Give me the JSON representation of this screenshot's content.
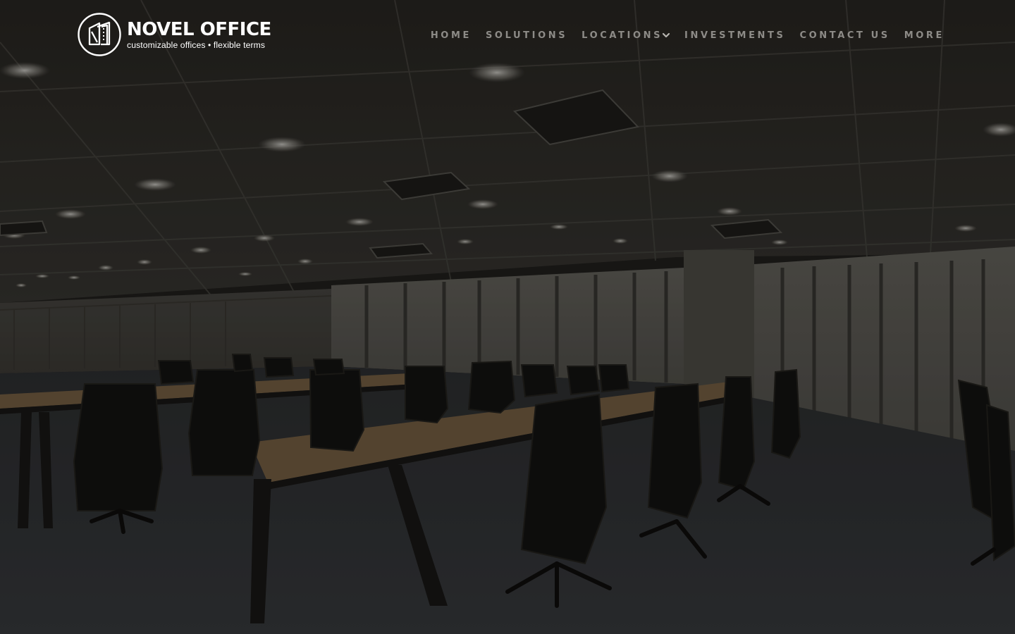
{
  "brand": {
    "name": "NOVEL OFFICE",
    "tagline": "customizable offices • flexible terms",
    "logo_icon": "building-icon"
  },
  "nav": {
    "items": [
      {
        "label": "HOME"
      },
      {
        "label": "SOLUTIONS"
      },
      {
        "label": "LOCATIONS",
        "has_dropdown": true
      },
      {
        "label": "INVESTMENTS"
      },
      {
        "label": "CONTACT US"
      },
      {
        "label": "MORE"
      }
    ]
  },
  "colors": {
    "nav_text": "#8d8b87",
    "logo": "#ffffff",
    "overlay": "#000000"
  }
}
